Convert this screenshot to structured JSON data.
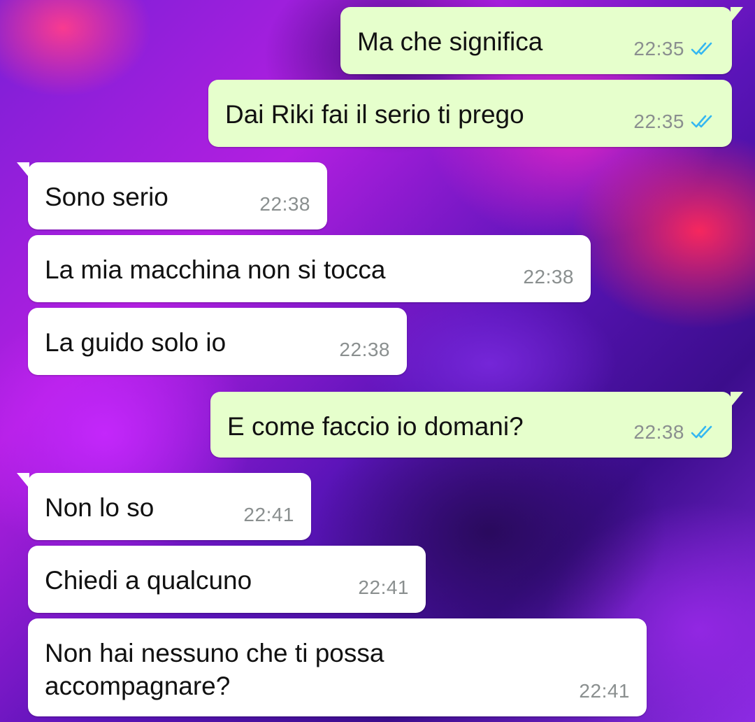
{
  "colors": {
    "incoming_bubble": "#ffffff",
    "outgoing_bubble": "#e6ffcc",
    "timestamp": "#8a8f8f",
    "read_ticks": "#34b7f1"
  },
  "messages": [
    {
      "text": "Ma che significa",
      "time": "22:35",
      "direction": "outgoing",
      "status": "read-ticks-icon"
    },
    {
      "text": "Dai Riki fai il serio ti prego",
      "time": "22:35",
      "direction": "outgoing",
      "status": "read-ticks-icon"
    },
    {
      "text": "Sono serio",
      "time": "22:38",
      "direction": "incoming"
    },
    {
      "text": "La mia macchina non si tocca",
      "time": "22:38",
      "direction": "incoming"
    },
    {
      "text": "La guido solo io",
      "time": "22:38",
      "direction": "incoming"
    },
    {
      "text": "E come faccio io domani?",
      "time": "22:38",
      "direction": "outgoing",
      "status": "read-ticks-icon"
    },
    {
      "text": "Non lo so",
      "time": "22:41",
      "direction": "incoming"
    },
    {
      "text": "Chiedi a qualcuno",
      "time": "22:41",
      "direction": "incoming"
    },
    {
      "text_line1": "Non hai nessuno che ti possa",
      "text_line2": "accompagnare?",
      "time": "22:41",
      "direction": "incoming"
    }
  ]
}
